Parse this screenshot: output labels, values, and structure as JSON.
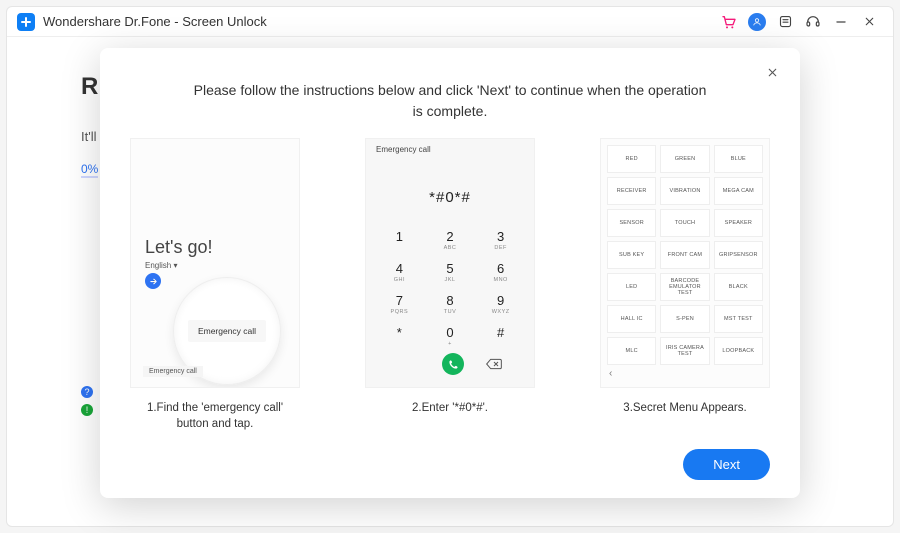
{
  "titlebar": {
    "app_title": "Wondershare Dr.Fone - Screen Unlock"
  },
  "behind": {
    "heading_fragment": "R",
    "subtext_fragment": "It'll",
    "progress": "0%"
  },
  "modal": {
    "instruction": "Please follow the instructions below and click 'Next' to continue when the operation is complete.",
    "next_label": "Next",
    "cards": [
      {
        "caption": "1.Find the 'emergency call' button and tap.",
        "lets_go": "Let's go!",
        "language": "English",
        "lens_button": "Emergency call",
        "bottom_button": "Emergency call"
      },
      {
        "caption": "2.Enter '*#0*#'.",
        "header": "Emergency call",
        "code": "*#0*#",
        "keys": [
          {
            "num": "1",
            "sub": ""
          },
          {
            "num": "2",
            "sub": "ABC"
          },
          {
            "num": "3",
            "sub": "DEF"
          },
          {
            "num": "4",
            "sub": "GHI"
          },
          {
            "num": "5",
            "sub": "JKL"
          },
          {
            "num": "6",
            "sub": "MNO"
          },
          {
            "num": "7",
            "sub": "PQRS"
          },
          {
            "num": "8",
            "sub": "TUV"
          },
          {
            "num": "9",
            "sub": "WXYZ"
          },
          {
            "num": "*",
            "sub": ""
          },
          {
            "num": "0",
            "sub": "+"
          },
          {
            "num": "#",
            "sub": ""
          }
        ]
      },
      {
        "caption": "3.Secret Menu Appears.",
        "cells": [
          "RED",
          "GREEN",
          "BLUE",
          "RECEIVER",
          "VIBRATION",
          "MEGA CAM",
          "SENSOR",
          "TOUCH",
          "SPEAKER",
          "SUB KEY",
          "FRONT CAM",
          "GRIPSENSOR",
          "LED",
          "BARCODE EMULATOR TEST",
          "BLACK",
          "HALL IC",
          "S-PEN",
          "MST TEST",
          "MLC",
          "IRIS CAMERA TEST",
          "LOOPBACK"
        ]
      }
    ]
  }
}
